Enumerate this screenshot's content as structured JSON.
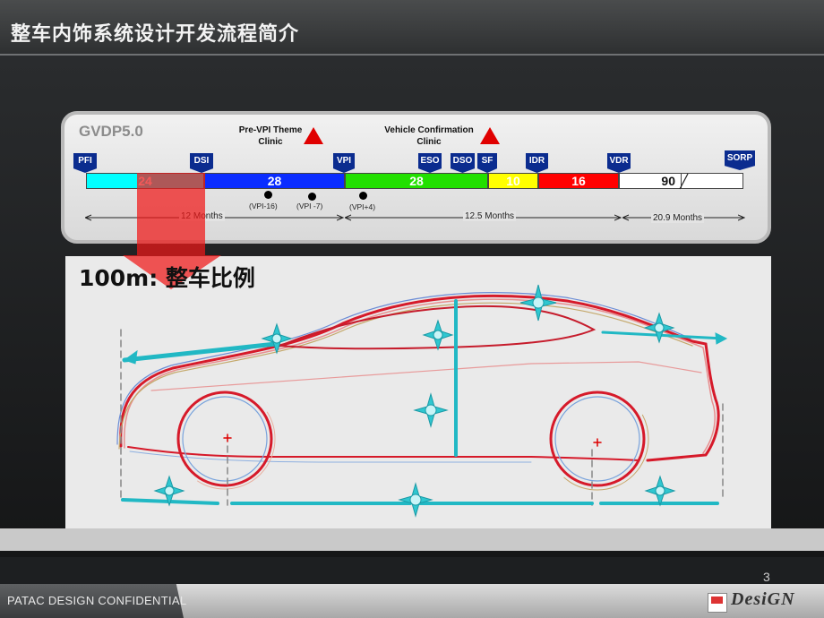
{
  "header": {
    "title": "整车内饰系统设计开发流程简介"
  },
  "timeline": {
    "label": "GVDP5.0",
    "notes": [
      {
        "line1": "Pre-VPI Theme",
        "line2": "Clinic"
      },
      {
        "line1": "Vehicle Confirmation",
        "line2": "Clinic"
      }
    ],
    "milestones": [
      "PFI",
      "DSI",
      "VPI",
      "ESO",
      "DSO",
      "SF",
      "IDR",
      "VDR",
      "SORP"
    ],
    "segments": [
      {
        "value": "24",
        "color": "#00ffff"
      },
      {
        "value": "28",
        "color": "#0a2cff"
      },
      {
        "value": "28",
        "color": "#22e000"
      },
      {
        "value": "10",
        "color": "#ffff00"
      },
      {
        "value": "16",
        "color": "#ff0000"
      },
      {
        "value": "90",
        "color": "#ffffff"
      }
    ],
    "vpi_labels": [
      "(VPI-16)",
      "(VPI -7)",
      "(VPI+4)"
    ],
    "durations": [
      "12 Months",
      "12.5 Months",
      "20.9 Months"
    ]
  },
  "diagram": {
    "title": "100m: 整车比例"
  },
  "footer": {
    "confidential": "PATAC DESIGN CONFIDENTIAL",
    "page": "3",
    "logo": "DesiGN"
  },
  "colors": {
    "accent_teal": "#21b8c4",
    "arrow_red": "#f01818"
  }
}
